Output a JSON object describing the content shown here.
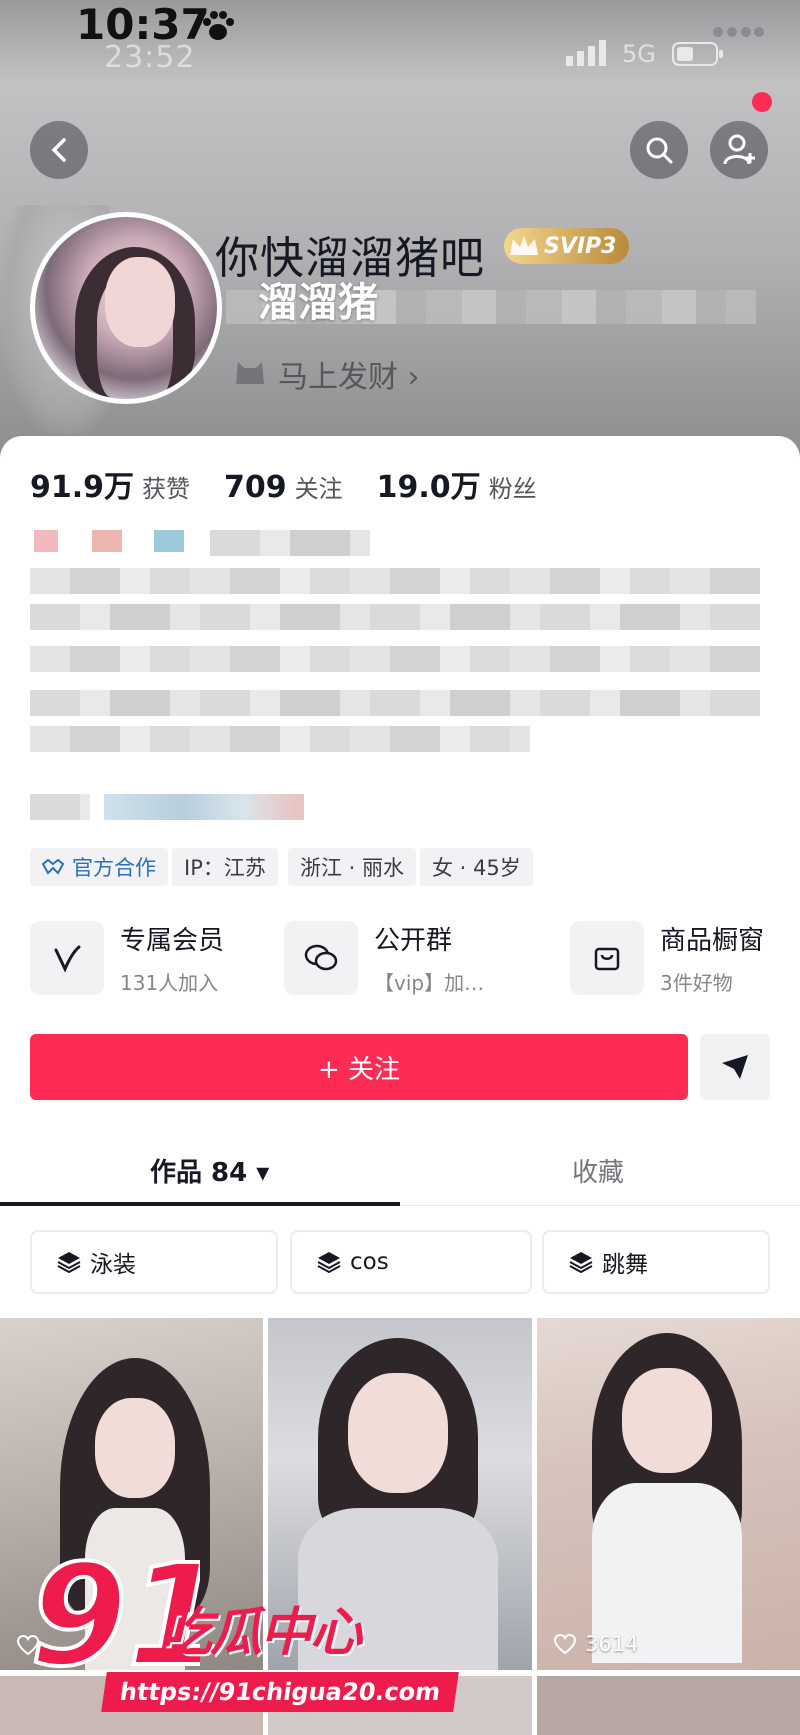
{
  "status_bar": {
    "time": "10:37",
    "time_faded": "23:52",
    "network": "5G"
  },
  "profile": {
    "nickname": "你快溜溜猪吧",
    "vip_badge": "SVIP3",
    "overlay_name": "溜溜猪",
    "fortune_tag": "马上发财 ›"
  },
  "stats": [
    {
      "num": "91.9万",
      "label": "获赞"
    },
    {
      "num": "709",
      "label": "关注"
    },
    {
      "num": "19.0万",
      "label": "粉丝"
    }
  ],
  "tags": {
    "official": "官方合作",
    "ip": "IP：江苏",
    "location": "浙江 · 丽水",
    "gender_age": "女 · 45岁"
  },
  "features": [
    {
      "title": "专属会员",
      "subtitle": "131人加入",
      "icon": "v-icon"
    },
    {
      "title": "公开群",
      "subtitle": "【vip】加…",
      "icon": "chat-icon"
    },
    {
      "title": "商品橱窗",
      "subtitle": "3件好物",
      "icon": "bag-icon"
    }
  ],
  "follow_button": "+ 关注",
  "tabs": {
    "works": "作品 84 ▾",
    "favorites": "收藏"
  },
  "collections": [
    "泳装",
    "cos",
    "跳舞"
  ],
  "thumbnails": [
    {
      "likes": ""
    },
    {
      "likes": ""
    },
    {
      "likes": "3614"
    }
  ],
  "watermark": {
    "logo_number": "91",
    "brand": "吃瓜中心",
    "url": "https://91chigua20.com"
  },
  "colors": {
    "accent": "#fe2c55",
    "watermark": "#ee1c4d",
    "vip_gold": "#c9a14a"
  }
}
